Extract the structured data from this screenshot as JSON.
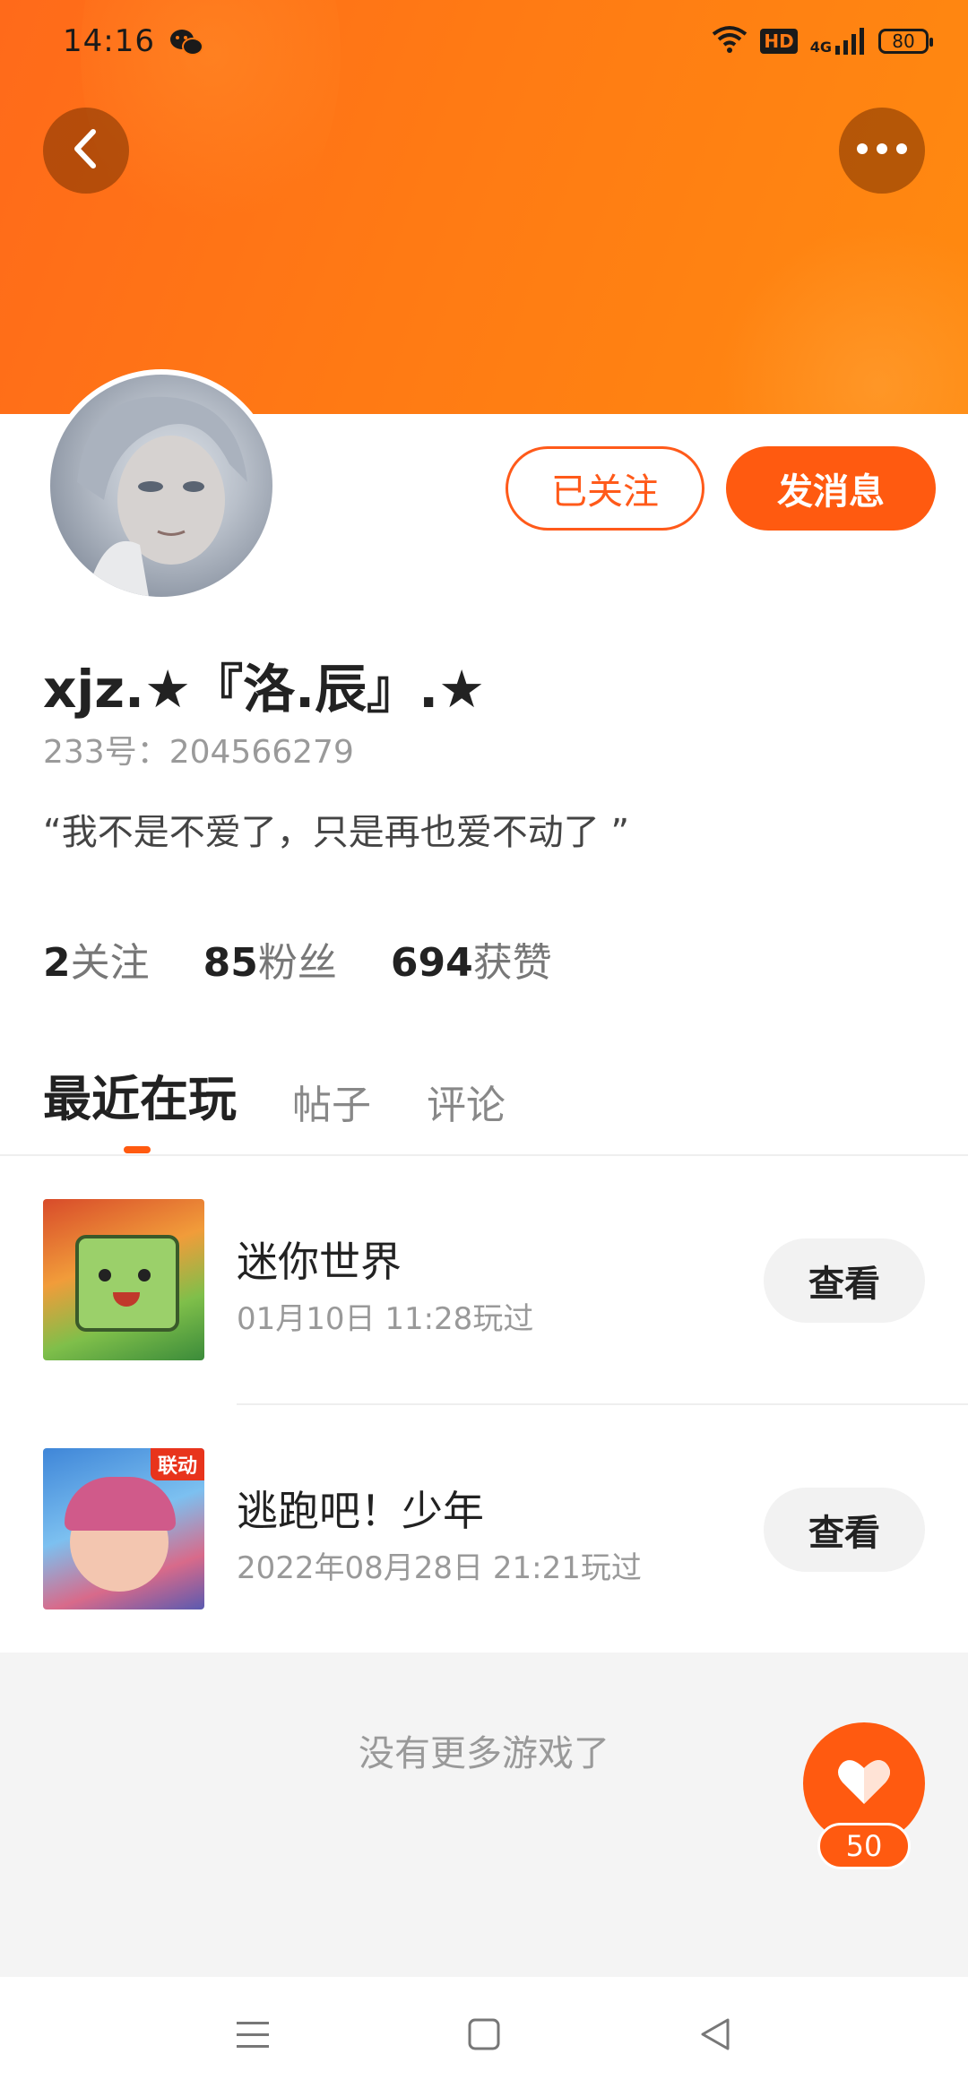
{
  "status_bar": {
    "time": "14:16",
    "hd": "HD",
    "network": "4G",
    "battery": "80"
  },
  "profile": {
    "username": "xjz.★『洛.辰』.★",
    "uid": "233号：204566279",
    "bio": "“我不是不爱了，只是再也爱不动了 ”",
    "followed_label": "已关注",
    "message_label": "发消息",
    "stats": [
      {
        "num": "2",
        "label": "关注"
      },
      {
        "num": "85",
        "label": "粉丝"
      },
      {
        "num": "694",
        "label": "获赞"
      }
    ]
  },
  "tabs": [
    {
      "label": "最近在玩",
      "active": true
    },
    {
      "label": "帖子",
      "active": false
    },
    {
      "label": "评论",
      "active": false
    }
  ],
  "games": [
    {
      "name": "迷你世界",
      "time": "01月10日 11:28玩过",
      "action": "查看",
      "icon": "mini-world-game-icon"
    },
    {
      "name": "逃跑吧！少年",
      "time": "2022年08月28日 21:21玩过",
      "action": "查看",
      "icon": "escape-youth-game-icon",
      "badge": "联动"
    }
  ],
  "footer": {
    "no_more": "没有更多游戏了",
    "like_count": "50"
  },
  "colors": {
    "accent": "#ff5a10",
    "banner": "#ff7a14"
  }
}
